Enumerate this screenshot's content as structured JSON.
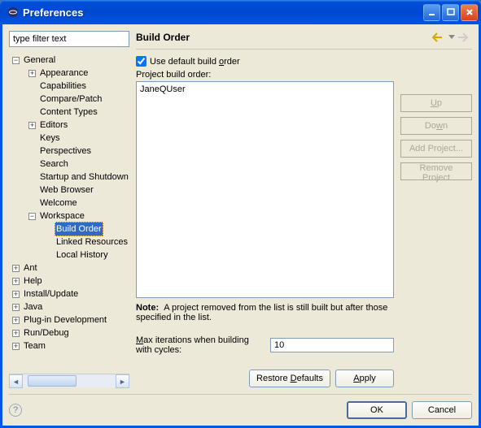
{
  "window": {
    "title": "Preferences"
  },
  "filter": {
    "placeholder": "type filter text"
  },
  "page": {
    "title": "Build Order",
    "use_default_label_prefix": "Use default build ",
    "use_default_label_ul": "o",
    "use_default_label_suffix": "rder",
    "use_default_checked": true,
    "list_label": "Project build order:",
    "note_label": "Note:",
    "note_text": "A project removed from the list is still built but after those specified in the list.",
    "iter_label_ul": "M",
    "iter_label_rest": "ax iterations when building with cycles:",
    "iter_value": "10"
  },
  "side_buttons": {
    "up_ul": "U",
    "up_rest": "p",
    "down_pre": "Do",
    "down_ul": "w",
    "down_post": "n",
    "add": "Add Project...",
    "remove": "Remove Project"
  },
  "lower_buttons": {
    "restore": "Restore ",
    "restore_ul": "D",
    "restore_post": "efaults",
    "apply_ul": "A",
    "apply_post": "pply"
  },
  "bottom_buttons": {
    "ok": "OK",
    "cancel": "Cancel"
  },
  "projects": [
    "JaneQUser"
  ],
  "tree": {
    "general": "General",
    "appearance": "Appearance",
    "capabilities": "Capabilities",
    "compare": "Compare/Patch",
    "content_types": "Content Types",
    "editors": "Editors",
    "keys": "Keys",
    "perspectives": "Perspectives",
    "search": "Search",
    "startup": "Startup and Shutdown",
    "web": "Web Browser",
    "welcome": "Welcome",
    "workspace": "Workspace",
    "build_order": "Build Order",
    "linked": "Linked Resources",
    "local_hist": "Local History",
    "ant": "Ant",
    "help": "Help",
    "install": "Install/Update",
    "java": "Java",
    "plugin": "Plug-in Development",
    "run": "Run/Debug",
    "team": "Team"
  }
}
